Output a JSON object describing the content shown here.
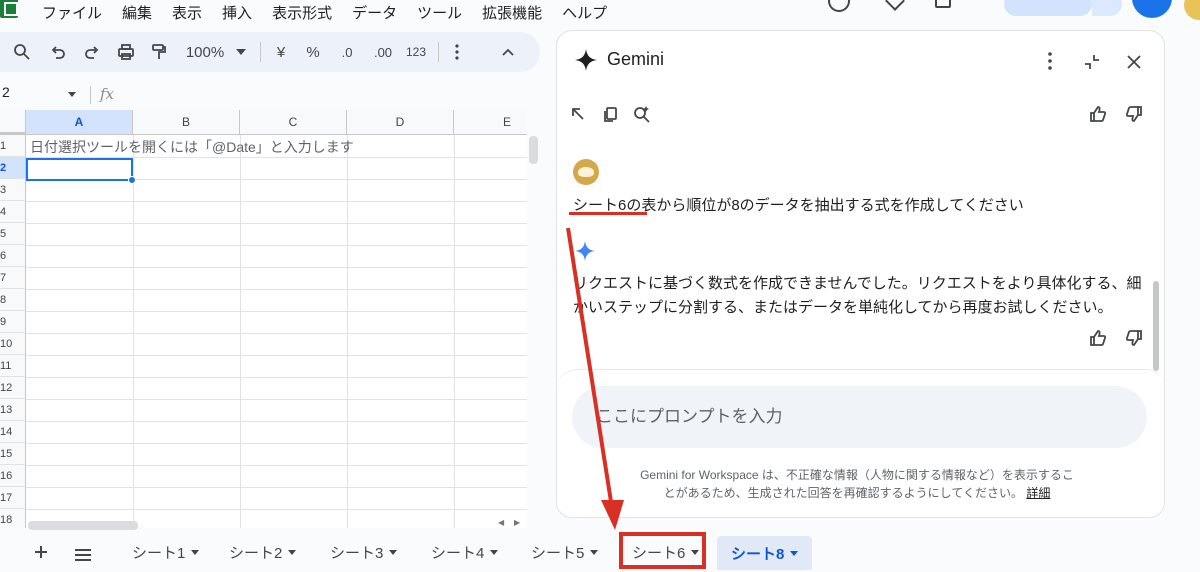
{
  "menu": [
    "ファイル",
    "編集",
    "表示",
    "挿入",
    "表示形式",
    "データ",
    "ツール",
    "拡張機能",
    "ヘルプ"
  ],
  "toolbar": {
    "zoom": "100%",
    "currency": "¥",
    "percent": "%",
    "decrease_decimal": ".0",
    "increase_decimal": ".00",
    "number_format": "123"
  },
  "formula_bar": {
    "name_box": "2",
    "fx_label": "fx"
  },
  "grid": {
    "columns": [
      "A",
      "B",
      "C",
      "D",
      "E"
    ],
    "rows": [
      "1",
      "2",
      "3",
      "4",
      "5",
      "6",
      "7",
      "8",
      "9",
      "10",
      "11",
      "12",
      "13",
      "14",
      "15",
      "16",
      "17",
      "18"
    ],
    "cell_A1_hint": "日付選択ツールを開くには「@Date」と入力します"
  },
  "gemini": {
    "title": "Gemini",
    "user_message": "シート6の表から順位が8のデータを抽出する式を作成してください",
    "response": "リクエストに基づく数式を作成できませんでした。リクエストをより具体化する、細かいステップに分割する、またはデータを単純化してから再度お試しください。",
    "input_placeholder": "ここにプロンプトを入力",
    "disclaimer": "Gemini for Workspace は、不正確な情報（人物に関する情報など）を表示することがあるため、生成された回答を再確認するようにしてください。",
    "disclaimer_link": "詳細"
  },
  "sheet_tabs": [
    {
      "label": "シート1"
    },
    {
      "label": "シート2"
    },
    {
      "label": "シート3"
    },
    {
      "label": "シート4"
    },
    {
      "label": "シート5"
    },
    {
      "label": "シート6"
    },
    {
      "label": "シート8"
    }
  ],
  "active_tab": "シート8",
  "annotation_color": "#d93025",
  "accent_color": "#0b57d0"
}
